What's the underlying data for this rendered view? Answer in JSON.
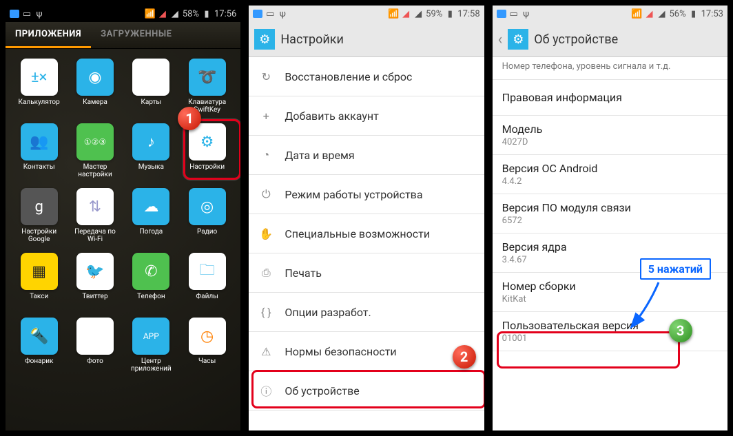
{
  "screen1": {
    "status": {
      "battery": "58%",
      "time": "17:56"
    },
    "tabs": {
      "apps": "ПРИЛОЖЕНИЯ",
      "downloaded": "ЗАГРУЖЕННЫЕ"
    },
    "apps": [
      {
        "label": "Калькулятор",
        "icon": "calc",
        "glyph": "±×"
      },
      {
        "label": "Камера",
        "icon": "camera",
        "glyph": "◉"
      },
      {
        "label": "Карты",
        "icon": "maps",
        "glyph": "▲"
      },
      {
        "label": "Клавиатура SwiftKey",
        "icon": "swiftkey",
        "glyph": "➰"
      },
      {
        "label": "Контакты",
        "icon": "contacts",
        "glyph": "👥"
      },
      {
        "label": "Мастер настройки",
        "icon": "wizard",
        "glyph": "①②③"
      },
      {
        "label": "Музыка",
        "icon": "music",
        "glyph": "♪"
      },
      {
        "label": "Настройки",
        "icon": "settings",
        "glyph": "⚙"
      },
      {
        "label": "Настройки Google",
        "icon": "gsettings",
        "glyph": "g"
      },
      {
        "label": "Передача по Wi-Fi",
        "icon": "wifitr",
        "glyph": "⇅"
      },
      {
        "label": "Погода",
        "icon": "weather",
        "glyph": "☁"
      },
      {
        "label": "Радио",
        "icon": "radio",
        "glyph": "◎"
      },
      {
        "label": "Такси",
        "icon": "taxi",
        "glyph": "▦"
      },
      {
        "label": "Твиттер",
        "icon": "twitter",
        "glyph": "🐦"
      },
      {
        "label": "Телефон",
        "icon": "phone",
        "glyph": "✆"
      },
      {
        "label": "Файлы",
        "icon": "files",
        "glyph": "🗀"
      },
      {
        "label": "Фонарик",
        "icon": "torch",
        "glyph": "🔦"
      },
      {
        "label": "Фото",
        "icon": "photos",
        "glyph": "✦"
      },
      {
        "label": "Центр приложений",
        "icon": "appcenter",
        "glyph": "APP"
      },
      {
        "label": "Часы",
        "icon": "clock",
        "glyph": "◷"
      }
    ],
    "badge1": "1"
  },
  "screen2": {
    "status": {
      "battery": "59%",
      "time": "17:58"
    },
    "title": "Настройки",
    "rows": [
      {
        "label": "Восстановление и сброс",
        "icon": "↻"
      },
      {
        "label": "Добавить аккаунт",
        "icon": "+"
      },
      {
        "label": "Дата и время",
        "icon": "◔"
      },
      {
        "label": "Режим работы устройства",
        "icon": "⏻"
      },
      {
        "label": "Специальные возможности",
        "icon": "✋"
      },
      {
        "label": "Печать",
        "icon": "⎙"
      },
      {
        "label": "Опции разработ.",
        "icon": "{ }"
      },
      {
        "label": "Нормы безопасности",
        "icon": "⚠"
      },
      {
        "label": "Об устройстве",
        "icon": "ⓘ"
      }
    ],
    "badge2": "2"
  },
  "screen3": {
    "status": {
      "battery": "56%",
      "time": "17:53"
    },
    "title": "Об устройстве",
    "subNote": "Номер телефона, уровень сигнала и т.д.",
    "items": [
      {
        "title": "Правовая информация",
        "val": null
      },
      {
        "title": "Модель",
        "val": "4027D"
      },
      {
        "title": "Версия ОС Android",
        "val": "4.4.2"
      },
      {
        "title": "Версия ПО модуля связи",
        "val": "6572"
      },
      {
        "title": "Версия ядра",
        "val": "3.4.67"
      },
      {
        "title": "Номер сборки",
        "val": "KitKat"
      },
      {
        "title": "Пользовательская версия",
        "val": "01001"
      }
    ],
    "annot": "5 нажатий",
    "badge3": "3"
  }
}
